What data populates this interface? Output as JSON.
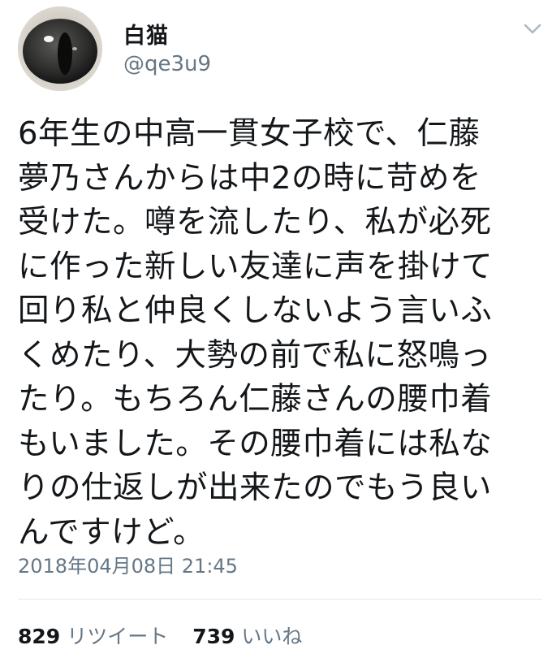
{
  "user": {
    "display_name": "白猫",
    "handle": "@qe3u9"
  },
  "tweet": {
    "text": "6年生の中高一貫女子校で、仁藤\n夢乃さんからは中2の時に苛めを\n受けた。噂を流したり、私が必死\nに作った新しい友達に声を掛けて\n回り私と仲良くしないよう言いふ\nくめたり、大勢の前で私に怒鳴っ\nたり。もちろん仁藤さんの腰巾着\nもいました。その腰巾着には私な\nりの仕返しが出来たのでもう良い\nんですけど。",
    "timestamp": "2018年04月08日 21:45"
  },
  "stats": {
    "retweets_count": "829",
    "retweets_label": "リツイート",
    "likes_count": "739",
    "likes_label": "いいね"
  },
  "icons": {
    "menu": "chevron-down-icon",
    "avatar": "cat-eye-avatar"
  },
  "colors": {
    "text": "#14171a",
    "secondary": "#657786",
    "divider": "#e1e8ed"
  }
}
